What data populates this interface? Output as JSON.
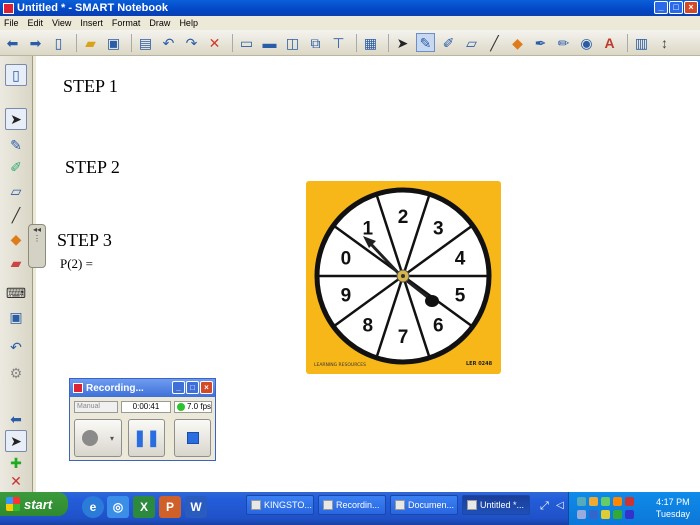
{
  "window": {
    "title": "Untitled * - SMART Notebook"
  },
  "menu": [
    "File",
    "Edit",
    "View",
    "Insert",
    "Format",
    "Draw",
    "Help"
  ],
  "canvas": {
    "step1": "STEP 1",
    "step2": "STEP 2",
    "step3": "STEP 3",
    "prob_label": "P(2) ="
  },
  "spinner": {
    "numbers": [
      "3",
      "4",
      "5",
      "6",
      "7",
      "8",
      "9",
      "0",
      "1",
      "2"
    ],
    "logo_text": "LEARNING RESOURCES",
    "product_code": "LER 0248",
    "colors": {
      "card": "#f7b718",
      "rim": "#111111",
      "face": "#ffffff"
    }
  },
  "recorder": {
    "title": "Recording...",
    "mode": "Manual",
    "elapsed": "0:00:41",
    "fps": "7.0 fps"
  },
  "taskbar": {
    "start": "start",
    "tasks": [
      {
        "label": "KINGSTO..."
      },
      {
        "label": "Recordin..."
      },
      {
        "label": "Documen..."
      },
      {
        "label": "Untitled *..."
      }
    ],
    "clock_time": "4:17 PM",
    "clock_day": "Tuesday"
  },
  "icons": {
    "toolbar": [
      "back-arrow-icon",
      "forward-arrow-icon",
      "add-page-icon",
      "open-folder-icon",
      "save-icon",
      "paste-icon",
      "undo-icon",
      "redo-icon",
      "delete-icon",
      "screen-shade-icon",
      "full-screen-icon",
      "dual-page-icon",
      "capture-icon",
      "document-camera-icon",
      "table-icon",
      "select-icon",
      "pen-icon",
      "creative-pen-icon",
      "eraser-icon",
      "line-icon",
      "shapes-icon",
      "magic-pen-icon",
      "shape-recognition-icon",
      "fill-icon",
      "text-icon",
      "properties-icon",
      "move-toolbar-icon"
    ]
  }
}
